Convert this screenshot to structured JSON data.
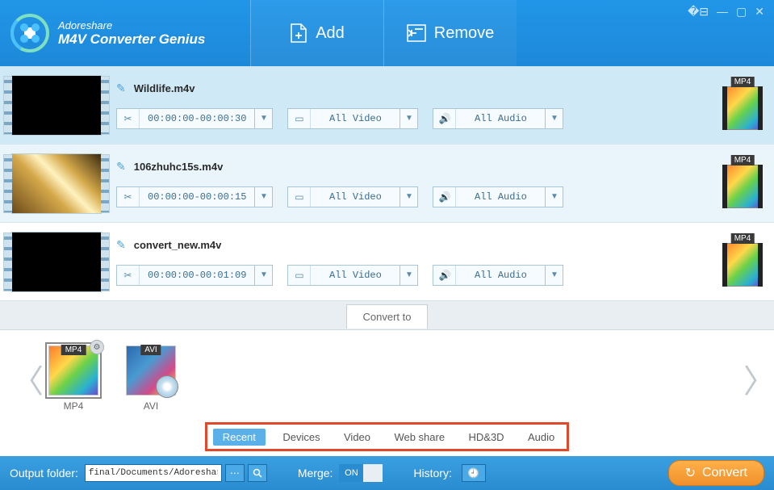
{
  "brand": {
    "line1": "Adoreshare",
    "line2": "M4V Converter Genius"
  },
  "header": {
    "add": "Add",
    "remove": "Remove"
  },
  "files": [
    {
      "name": "Wildlife.m4v",
      "time": "00:00:00-00:00:30",
      "video": "All Video",
      "audio": "All Audio",
      "format": "MP4"
    },
    {
      "name": "106zhuhc15s.m4v",
      "time": "00:00:00-00:00:15",
      "video": "All Video",
      "audio": "All Audio",
      "format": "MP4"
    },
    {
      "name": "convert_new.m4v",
      "time": "00:00:00-00:01:09",
      "video": "All Video",
      "audio": "All Audio",
      "format": "MP4"
    }
  ],
  "convert_to_label": "Convert to",
  "formats": [
    {
      "label": "MP4",
      "badge": "MP4"
    },
    {
      "label": "AVI",
      "badge": "AVI"
    }
  ],
  "categories": [
    "Recent",
    "Devices",
    "Video",
    "Web share",
    "HD&3D",
    "Audio"
  ],
  "bottom": {
    "output_label": "Output folder:",
    "output_path": "final/Documents/Adoreshare",
    "merge_label": "Merge:",
    "merge_on": "ON",
    "history_label": "History:",
    "convert": "Convert"
  }
}
